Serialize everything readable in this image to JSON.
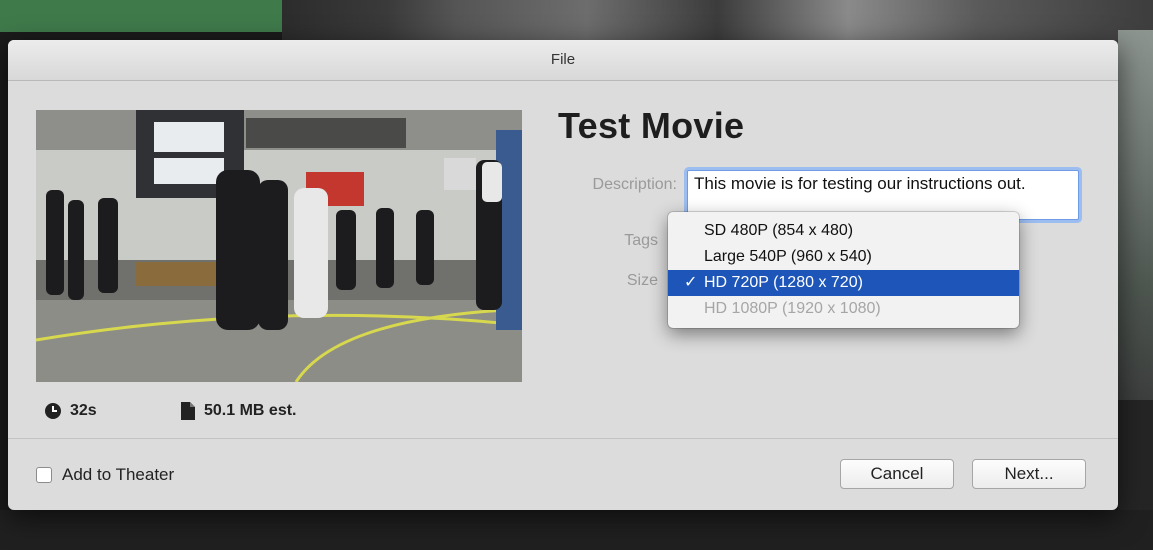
{
  "dialog": {
    "title": "File",
    "movie_title": "Test Movie",
    "description_label": "Description:",
    "description_value": "This movie is for testing our instructions out.",
    "tags_label": "Tags",
    "size_label": "Size",
    "duration": "32s",
    "file_size": "50.1 MB est.",
    "add_to_theater_label": "Add to Theater",
    "cancel_label": "Cancel",
    "next_label": "Next..."
  },
  "size_menu": {
    "items": [
      {
        "label": "SD 480P (854 x 480)",
        "state": "normal"
      },
      {
        "label": "Large 540P (960 x 540)",
        "state": "normal"
      },
      {
        "label": "HD 720P (1280 x 720)",
        "state": "selected"
      },
      {
        "label": "HD 1080P (1920 x 1080)",
        "state": "disabled"
      }
    ],
    "check_mark": "✓"
  },
  "icons": {
    "duration": "clock-icon",
    "file_size": "document-icon"
  },
  "colors": {
    "selection": "#1d56b8",
    "focus_ring": "#9cbdf0"
  }
}
